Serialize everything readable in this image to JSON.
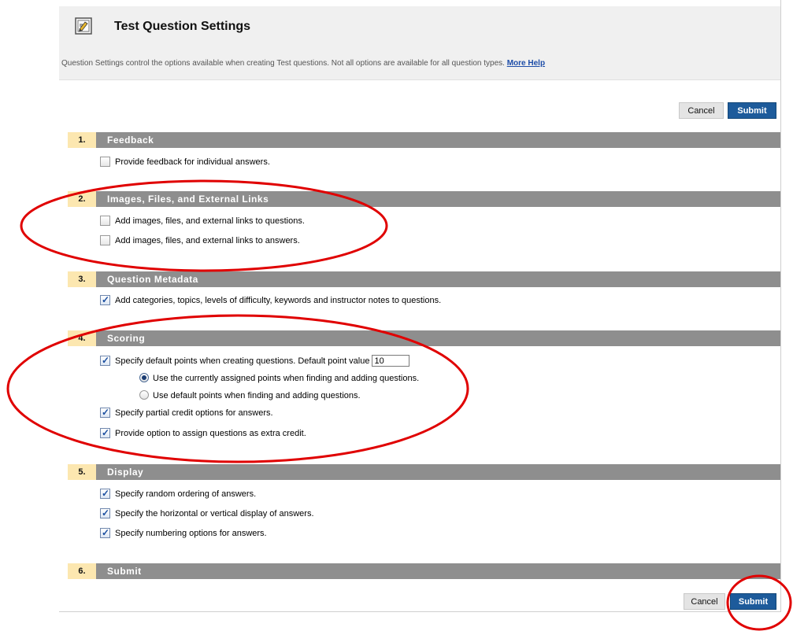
{
  "header": {
    "title": "Test Question Settings",
    "description": "Question Settings control the options available when creating Test questions. Not all options are available for all question types.",
    "help_link": "More Help"
  },
  "buttons": {
    "cancel": "Cancel",
    "submit": "Submit"
  },
  "sections": [
    {
      "number": "1.",
      "title": "Feedback"
    },
    {
      "number": "2.",
      "title": "Images, Files, and External Links"
    },
    {
      "number": "3.",
      "title": "Question Metadata"
    },
    {
      "number": "4.",
      "title": "Scoring"
    },
    {
      "number": "5.",
      "title": "Display"
    },
    {
      "number": "6.",
      "title": "Submit"
    }
  ],
  "options": {
    "feedback_individual": {
      "label": "Provide feedback for individual answers.",
      "checked": false
    },
    "links_questions": {
      "label": "Add images, files, and external links to questions.",
      "checked": false
    },
    "links_answers": {
      "label": "Add images, files, and external links to answers.",
      "checked": false
    },
    "metadata": {
      "label": "Add categories, topics, levels of difficulty, keywords and instructor notes to questions.",
      "checked": true
    },
    "default_points": {
      "label": "Specify default points when creating questions. Default point value",
      "checked": true,
      "value": "10"
    },
    "use_assigned_points": {
      "label": "Use the currently assigned points when finding and adding questions.",
      "selected": true
    },
    "use_default_points": {
      "label": "Use default points when finding and adding questions.",
      "selected": false
    },
    "partial_credit": {
      "label": "Specify partial credit options for answers.",
      "checked": true
    },
    "extra_credit": {
      "label": "Provide option to assign questions as extra credit.",
      "checked": true
    },
    "random_ordering": {
      "label": "Specify random ordering of answers.",
      "checked": true
    },
    "horizontal_vertical": {
      "label": "Specify the horizontal or vertical display of answers.",
      "checked": true
    },
    "numbering": {
      "label": "Specify numbering options for answers.",
      "checked": true
    }
  },
  "colors": {
    "section_bar": "#8e8e8e",
    "section_number_bg": "#fce7b0",
    "submit_button": "#1d5b9b",
    "annotation": "#e00000"
  }
}
